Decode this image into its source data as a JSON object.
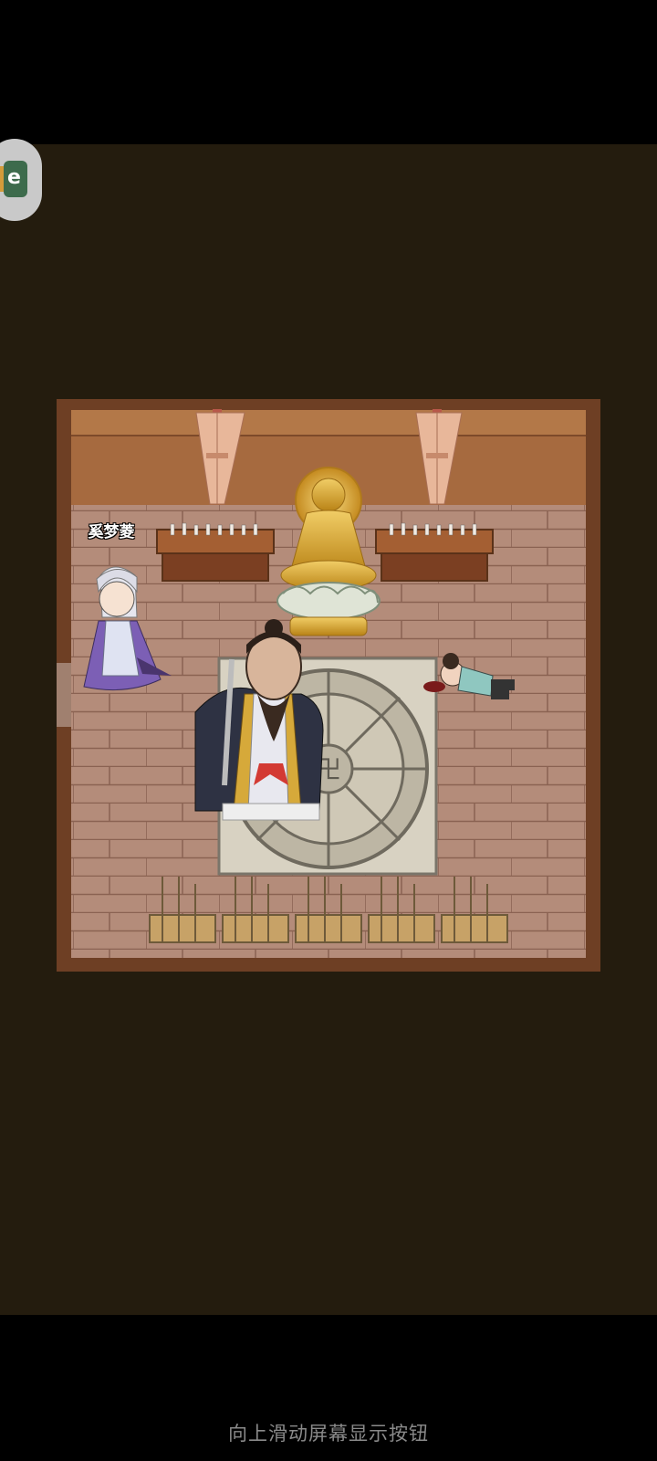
{
  "game": {
    "character_name": "奚梦菱",
    "hint": "向上滑动屏幕显示按钮",
    "floating_button_icon": "app-logo-icon",
    "colors": {
      "background": "#241c0e",
      "room_border": "#6e3f24",
      "floor": "#b68f7c",
      "wall": "#a66a3f",
      "statue_gold": "#d8a93a"
    }
  }
}
